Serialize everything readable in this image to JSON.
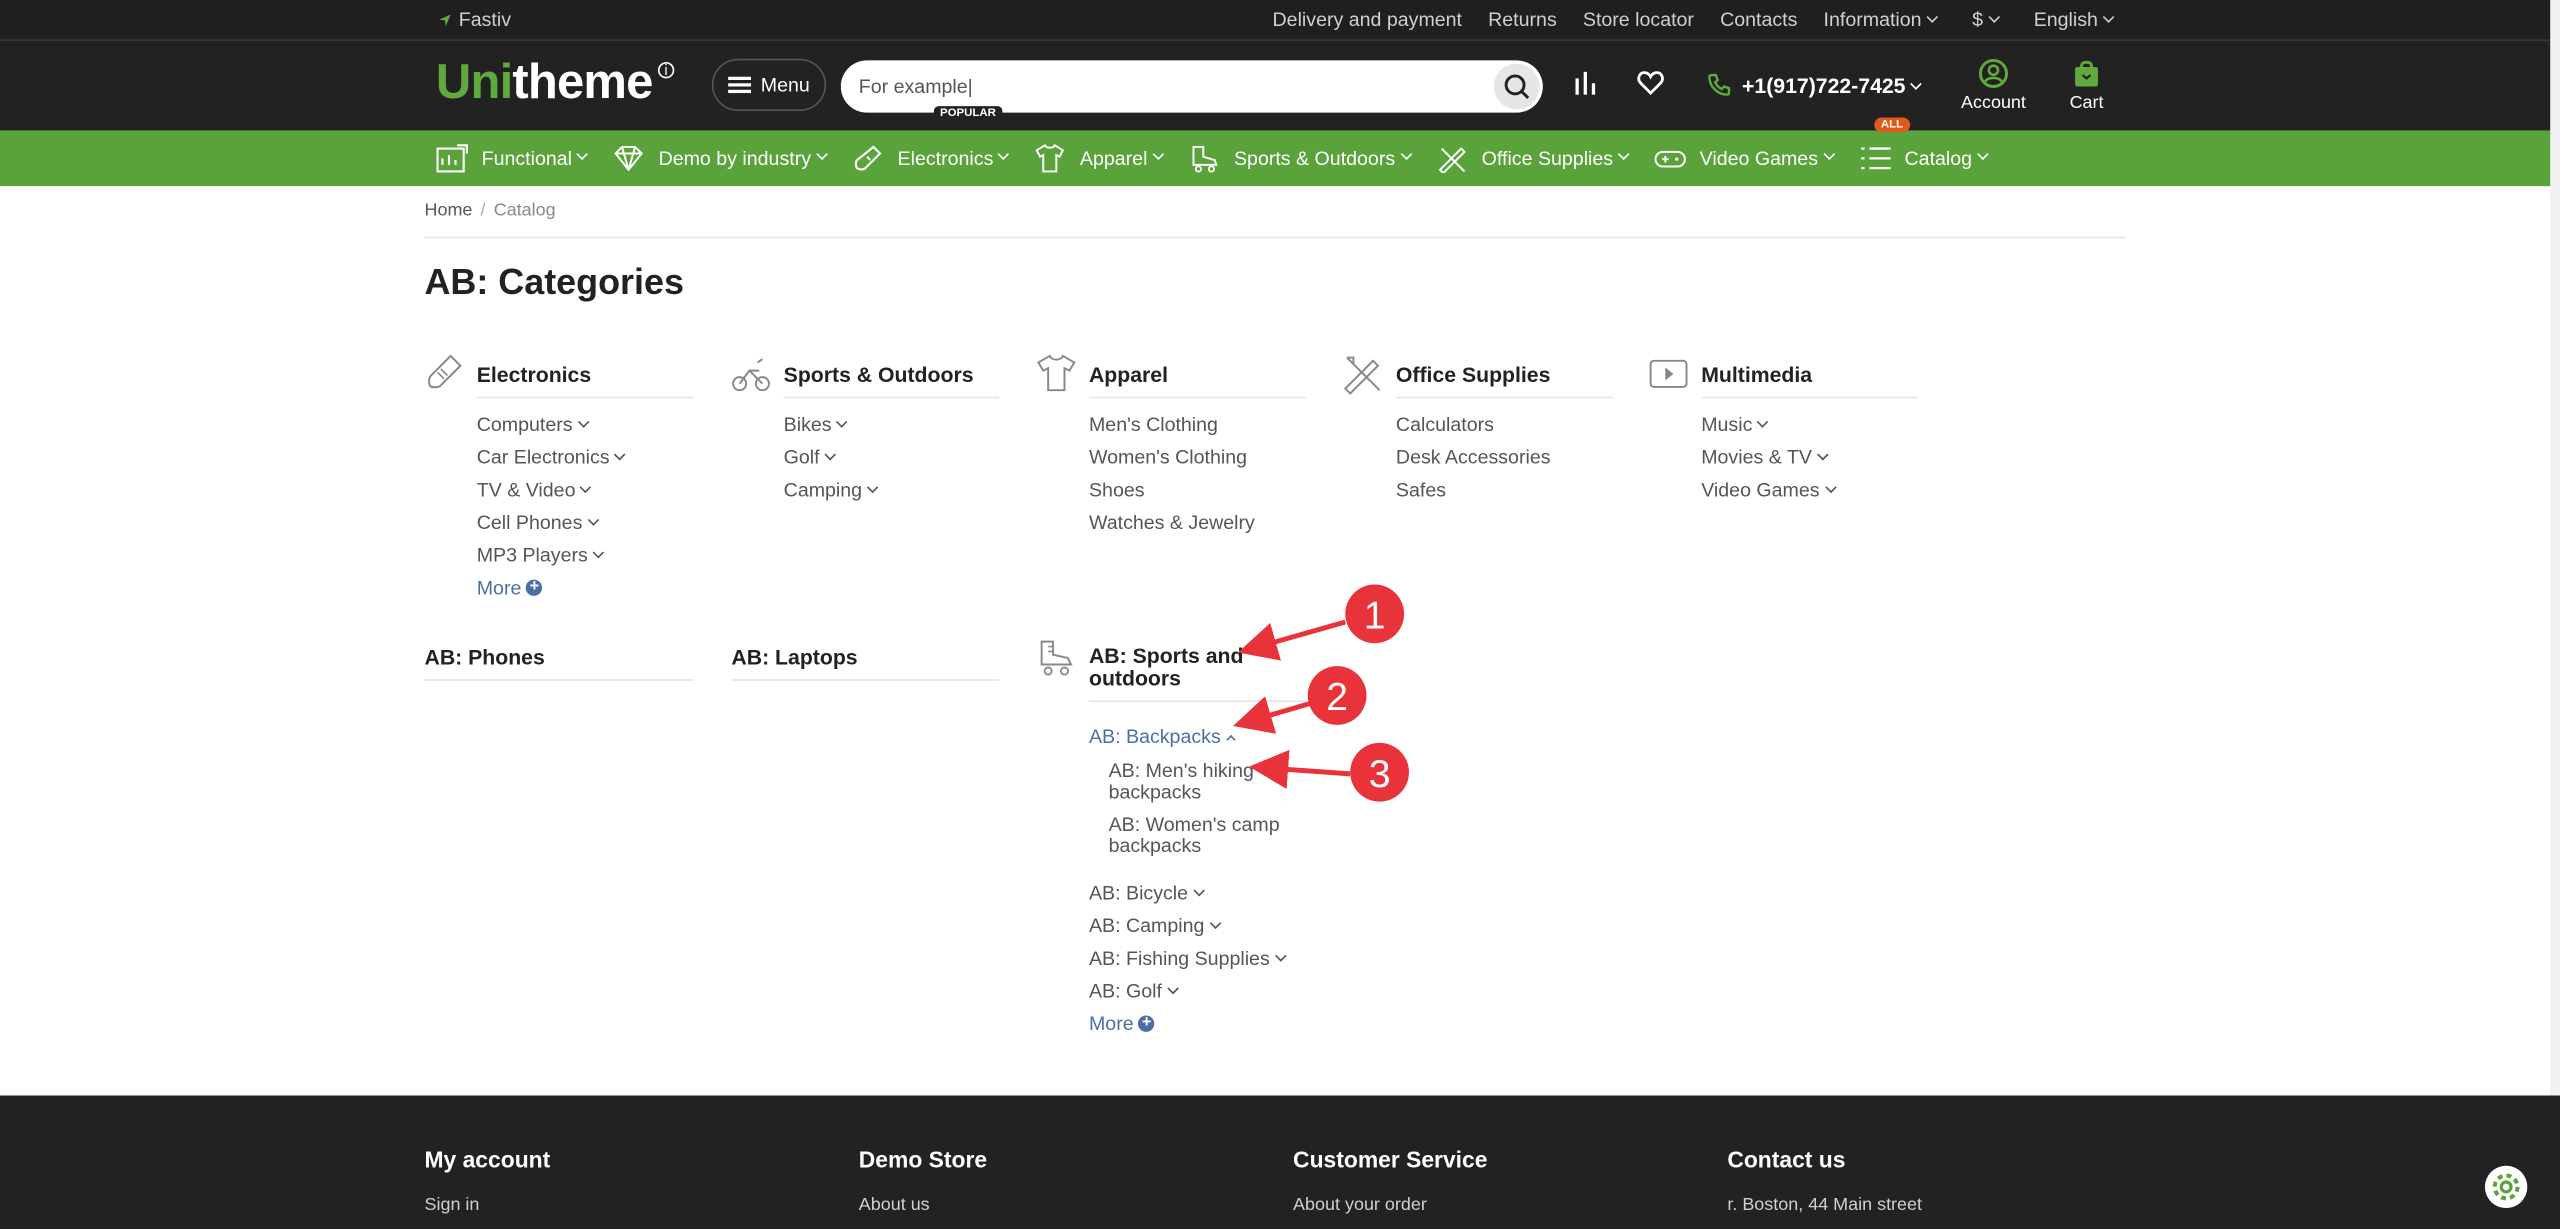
{
  "topbar": {
    "location": "Fastiv",
    "links": [
      "Delivery and payment",
      "Returns",
      "Store locator",
      "Contacts"
    ],
    "information": "Information",
    "currency": "$",
    "language": "English"
  },
  "header": {
    "logo_green": "Uni",
    "logo_white": "theme",
    "menu_label": "Menu",
    "search_value": "For example|",
    "phone": "+1(917)722-7425",
    "account_label": "Account",
    "cart_label": "Cart"
  },
  "nav": {
    "popular_badge": "POPULAR",
    "all_badge": "ALL",
    "items": [
      "Functional",
      "Demo by industry",
      "Electronics",
      "Apparel",
      "Sports & Outdoors",
      "Office Supplies",
      "Video Games",
      "Catalog"
    ]
  },
  "breadcrumb": {
    "home": "Home",
    "separator": "/",
    "current": "Catalog"
  },
  "page_title": "AB: Categories",
  "categories": {
    "electronics": {
      "title": "Electronics",
      "items": [
        "Computers",
        "Car Electronics",
        "TV & Video",
        "Cell Phones",
        "MP3 Players"
      ],
      "more": "More"
    },
    "sports": {
      "title": "Sports & Outdoors",
      "items": [
        "Bikes",
        "Golf",
        "Camping"
      ]
    },
    "apparel": {
      "title": "Apparel",
      "items": [
        "Men's Clothing",
        "Women's Clothing",
        "Shoes",
        "Watches & Jewelry"
      ]
    },
    "office": {
      "title": "Office Supplies",
      "items": [
        "Calculators",
        "Desk Accessories",
        "Safes"
      ]
    },
    "multimedia": {
      "title": "Multimedia",
      "items": [
        "Music",
        "Movies & TV",
        "Video Games"
      ]
    },
    "phones": {
      "title": "AB: Phones"
    },
    "laptops": {
      "title": "AB: Laptops"
    },
    "ab_sports": {
      "title_line1": "AB: Sports and",
      "title_line2": "outdoors",
      "backpacks": "AB: Backpacks",
      "sub": [
        "AB: Men's hiking",
        "backpacks",
        "AB: Women's camp",
        "backpacks"
      ],
      "items": [
        "AB: Bicycle",
        "AB: Camping",
        "AB: Fishing Supplies",
        "AB: Golf"
      ],
      "more": "More"
    }
  },
  "annotations": [
    "1",
    "2",
    "3"
  ],
  "footer": {
    "cols": [
      {
        "title": "My account",
        "link": "Sign in"
      },
      {
        "title": "Demo Store",
        "link": "About us"
      },
      {
        "title": "Customer Service",
        "link": "About your order"
      },
      {
        "title": "Contact us",
        "link": "r. Boston, 44 Main street"
      }
    ]
  },
  "colors": {
    "green": "#5aa33b",
    "dark": "#222222",
    "link_blue": "#4a6fa5",
    "annotation_red": "#e8333a"
  }
}
